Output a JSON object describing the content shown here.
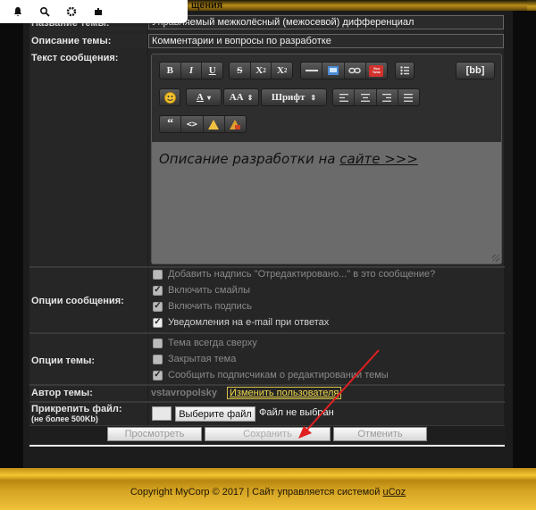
{
  "header": {
    "partial_title": "щения"
  },
  "form": {
    "topic_title_label": "Название темы:",
    "topic_title_value": "Управляемый межколёсный (межосевой) дифференциал",
    "topic_desc_label": "Описание темы:",
    "topic_desc_value": "Комментарии и вопросы по разработке",
    "message_label": "Текст сообщения:",
    "message_text": "Описание разработки на ",
    "message_link": "сайте >>>",
    "message_options_label": "Опции сообщения:",
    "message_options": [
      {
        "label": "Добавить надпись \"Отредактировано...\" в это сообщение?",
        "checked": false,
        "enabled": false
      },
      {
        "label": "Включить смайлы",
        "checked": true,
        "enabled": false
      },
      {
        "label": "Включить подпись",
        "checked": true,
        "enabled": false
      },
      {
        "label": "Уведомления на e-mail при ответах",
        "checked": true,
        "enabled": true
      }
    ],
    "topic_options_label": "Опции темы:",
    "topic_options": [
      {
        "label": "Тема всегда сверху",
        "checked": false,
        "enabled": false
      },
      {
        "label": "Закрытая тема",
        "checked": false,
        "enabled": false
      },
      {
        "label": "Сообщить подписчикам о редактировании темы",
        "checked": true,
        "enabled": false
      }
    ],
    "author_label": "Автор темы:",
    "author_name": "vstavropolsky",
    "change_user": "Изменить пользователя",
    "attach_label": "Прикрепить файл:",
    "attach_limit": "(не более 500Kb)",
    "choose_file": "Выберите файл",
    "file_status": "Файл не выбран",
    "preview_button": "Просмотреть",
    "save_button": "Сохранить",
    "cancel_button": "Отменить"
  },
  "editor": {
    "bold": "B",
    "italic": "I",
    "underline": "U",
    "strike": "S",
    "superscript": "X",
    "subscript": "X",
    "bb": "[bb]",
    "font": "Шрифт",
    "font_size": "AA",
    "font_color": "A",
    "youtube": "You Tube"
  },
  "footer": {
    "copyright": "Copyright MyCorp © 2017 | Сайт управляется системой ",
    "ucoz": "uCoz"
  },
  "colors": {
    "gold": "#d1a020",
    "panel": "#262626",
    "arrow": "#e02020"
  }
}
